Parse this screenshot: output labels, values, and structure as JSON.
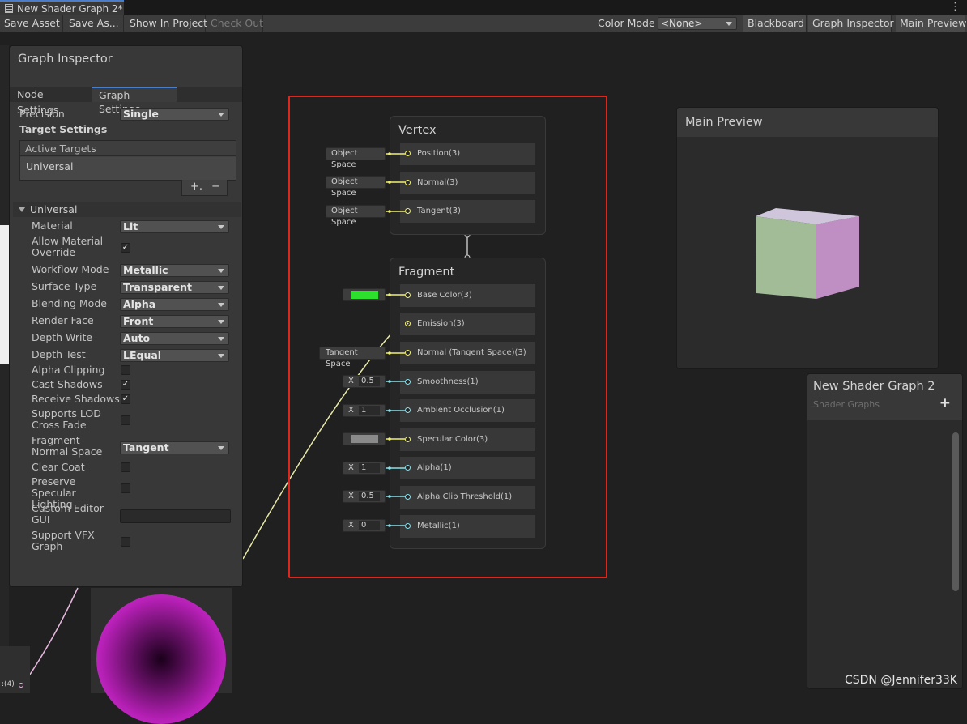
{
  "window": {
    "tab_title": "New Shader Graph 2*",
    "menu_glyph": "⋮"
  },
  "toolbar": {
    "save_asset": "Save Asset",
    "save_as": "Save As...",
    "show_in_project": "Show In Project",
    "check_out": "Check Out",
    "color_mode_label": "Color Mode",
    "color_mode_value": "<None>",
    "blackboard": "Blackboard",
    "graph_inspector": "Graph Inspector",
    "main_preview": "Main Preview"
  },
  "inspector": {
    "title": "Graph Inspector",
    "tabs": [
      "Node Settings",
      "Graph Settings"
    ],
    "active_tab": "Graph Settings",
    "precision_label": "Precision",
    "precision_value": "Single",
    "target_settings": "Target Settings",
    "active_targets": "Active Targets",
    "target_item": "Universal",
    "add_glyph": "+.",
    "remove_glyph": "−",
    "section": "Universal",
    "material_label": "Material",
    "material_value": "Lit",
    "allow_override_label": "Allow Material Override",
    "workflow_label": "Workflow Mode",
    "workflow_value": "Metallic",
    "surface_label": "Surface Type",
    "surface_value": "Transparent",
    "blending_label": "Blending Mode",
    "blending_value": "Alpha",
    "render_face_label": "Render Face",
    "render_face_value": "Front",
    "depth_write_label": "Depth Write",
    "depth_write_value": "Auto",
    "depth_test_label": "Depth Test",
    "depth_test_value": "LEqual",
    "alpha_clip_label": "Alpha Clipping",
    "cast_shadows_label": "Cast Shadows",
    "receive_shadows_label": "Receive Shadows",
    "lod_label": "Supports LOD Cross Fade",
    "frag_normal_label": "Fragment Normal Space",
    "frag_normal_value": "Tangent",
    "clear_coat_label": "Clear Coat",
    "preserve_spec_label": "Preserve Specular Lighting",
    "custom_gui_label": "Custom Editor GUI",
    "vfx_label": "Support VFX Graph",
    "checks": {
      "allow_override": true,
      "alpha_clip": false,
      "cast_shadows": true,
      "receive_shadows": true,
      "lod": false,
      "clear_coat": false,
      "preserve_spec": false,
      "vfx": false
    }
  },
  "vertex": {
    "title": "Vertex",
    "ports": [
      {
        "label": "Position(3)",
        "stub": "Object Space"
      },
      {
        "label": "Normal(3)",
        "stub": "Object Space"
      },
      {
        "label": "Tangent(3)",
        "stub": "Object Space"
      }
    ]
  },
  "fragment": {
    "title": "Fragment",
    "ports": [
      {
        "label": "Base Color(3)",
        "kind": "color",
        "color": "#2ee02e"
      },
      {
        "label": "Emission(3)",
        "kind": "connected"
      },
      {
        "label": "Normal (Tangent Space)(3)",
        "kind": "stub",
        "stub": "Tangent Space"
      },
      {
        "label": "Smoothness(1)",
        "kind": "x",
        "value": "0.5"
      },
      {
        "label": "Ambient Occlusion(1)",
        "kind": "x",
        "value": "1"
      },
      {
        "label": "Specular Color(3)",
        "kind": "color",
        "color": "#8a8a8a"
      },
      {
        "label": "Alpha(1)",
        "kind": "x",
        "value": "1"
      },
      {
        "label": "Alpha Clip Threshold(1)",
        "kind": "x",
        "value": "0.5"
      },
      {
        "label": "Metallic(1)",
        "kind": "x",
        "value": "0"
      }
    ],
    "x_label": "X"
  },
  "main_preview": {
    "title": "Main Preview"
  },
  "blackboard": {
    "title": "New Shader Graph 2",
    "subtitle": "Shader Graphs",
    "add_glyph": "+"
  },
  "left_fragment": {
    "port_label": ":(4)"
  },
  "watermark": "CSDN @Jennifer33K",
  "colors": {
    "accent": "#4b7ec8",
    "highlight_box": "#e0261c",
    "vector_port": "#f0f06e",
    "float_port": "#8ae0ea"
  }
}
